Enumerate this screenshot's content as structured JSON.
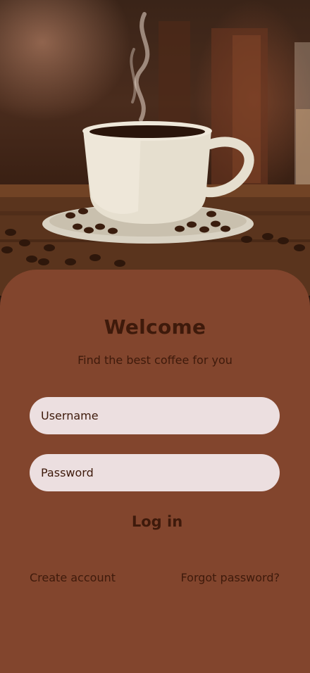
{
  "hero": {
    "image": "coffee-cup-photo"
  },
  "login": {
    "title": "Welcome",
    "subtitle": "Find the best coffee for you",
    "username_placeholder": "Username",
    "password_placeholder": "Password",
    "login_label": "Log in",
    "create_account_label": "Create account",
    "forgot_password_label": "Forgot password?"
  },
  "colors": {
    "card_background": "#82452d",
    "field_background": "#ecdfe0",
    "text": "#3e1a0b"
  }
}
